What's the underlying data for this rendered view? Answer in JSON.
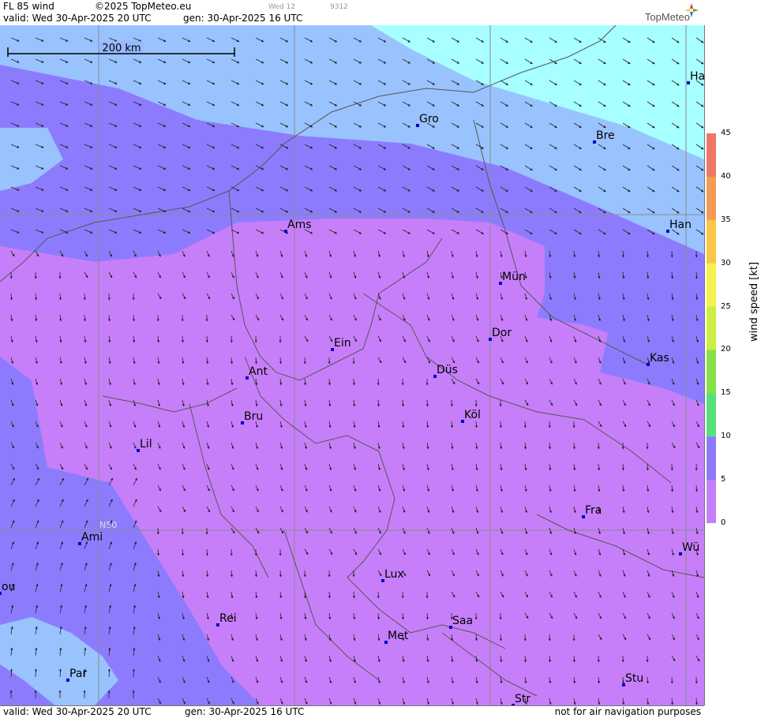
{
  "header": {
    "product": "FL 85 wind",
    "copyright": "©2025 TopMeteo.eu",
    "valid": "valid:  Wed  30-Apr-2025  20 UTC",
    "generated": "gen: 30-Apr-2025 16 UTC",
    "small_day": "Wed 12",
    "small_code": "9312",
    "logo": "TopMeteo"
  },
  "footer": {
    "valid": "valid:  Wed  30-Apr-2025  20 UTC",
    "generated": "gen: 30-Apr-2025 16 UTC",
    "disclaimer": "not for air navigation purposes"
  },
  "scale_bar": "200 km",
  "graticule_label": "N50",
  "legend": {
    "title": "wind  speed  [kt]",
    "ticks": [
      "45",
      "40",
      "35",
      "30",
      "25",
      "20",
      "15",
      "10",
      "5",
      "0"
    ],
    "colors": [
      "#ef7767",
      "#f69a55",
      "#f8c64a",
      "#f3f24e",
      "#cdee45",
      "#86e04a",
      "#57e07a",
      "#a7ffff",
      "#99c3ff",
      "#8c7cfd",
      "#c77ff9"
    ]
  },
  "cities": [
    {
      "name": "Gro"
    },
    {
      "name": "Bre"
    },
    {
      "name": "Ha"
    },
    {
      "name": "Ams"
    },
    {
      "name": "Han"
    },
    {
      "name": "Mün"
    },
    {
      "name": "Dor"
    },
    {
      "name": "Ein"
    },
    {
      "name": "Ant"
    },
    {
      "name": "Düs"
    },
    {
      "name": "Kas"
    },
    {
      "name": "Bru"
    },
    {
      "name": "Köl"
    },
    {
      "name": "Lil"
    },
    {
      "name": "Fra"
    },
    {
      "name": "Ami"
    },
    {
      "name": "Wü"
    },
    {
      "name": "Lux"
    },
    {
      "name": "Rei"
    },
    {
      "name": "Saa"
    },
    {
      "name": "Met"
    },
    {
      "name": "Par"
    },
    {
      "name": "Stu"
    },
    {
      "name": "Str"
    },
    {
      "name": "ou"
    }
  ]
}
